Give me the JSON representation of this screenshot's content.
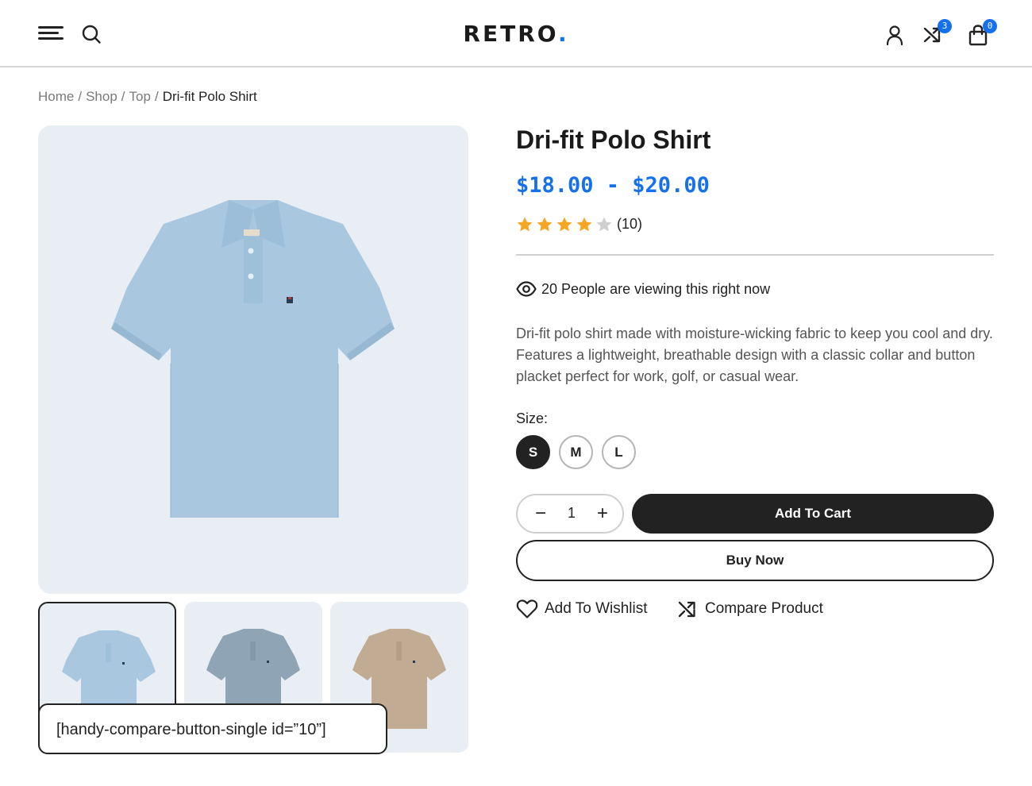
{
  "header": {
    "logo_text": "RETRO",
    "logo_dot": ".",
    "compare_count": "3",
    "cart_count": "0",
    "accent_color": "#1570ef"
  },
  "breadcrumb": {
    "items": [
      "Home",
      "Shop",
      "Top"
    ],
    "separator": "/",
    "current": "Dri-fit Polo Shirt"
  },
  "product": {
    "title": "Dri-fit Polo Shirt",
    "price": "$18.00 - $20.00",
    "rating": 4,
    "rating_max": 5,
    "review_count": "(10)",
    "viewers_text": "20 People are viewing this right now",
    "description": "Dri-fit polo shirt made with moisture-wicking fabric to keep you cool and dry. Features a lightweight, breathable design with a classic collar and button placket perfect for work, golf, or casual wear.",
    "size_label": "Size:",
    "sizes": [
      "S",
      "M",
      "L"
    ],
    "selected_size": "S",
    "quantity": "1",
    "quantity_minus": "−",
    "quantity_plus": "+",
    "add_to_cart_label": "Add To Cart",
    "buy_now_label": "Buy Now",
    "wishlist_label": "Add To Wishlist",
    "compare_label": "Compare Product"
  },
  "gallery": {
    "main_color": "#a9c8e0",
    "thumbnail_colors": [
      "#a9c8e0",
      "#8fa4b4",
      "#c1ab93"
    ]
  },
  "shortcode": {
    "text": "[handy-compare-button-single id=”10”]"
  }
}
